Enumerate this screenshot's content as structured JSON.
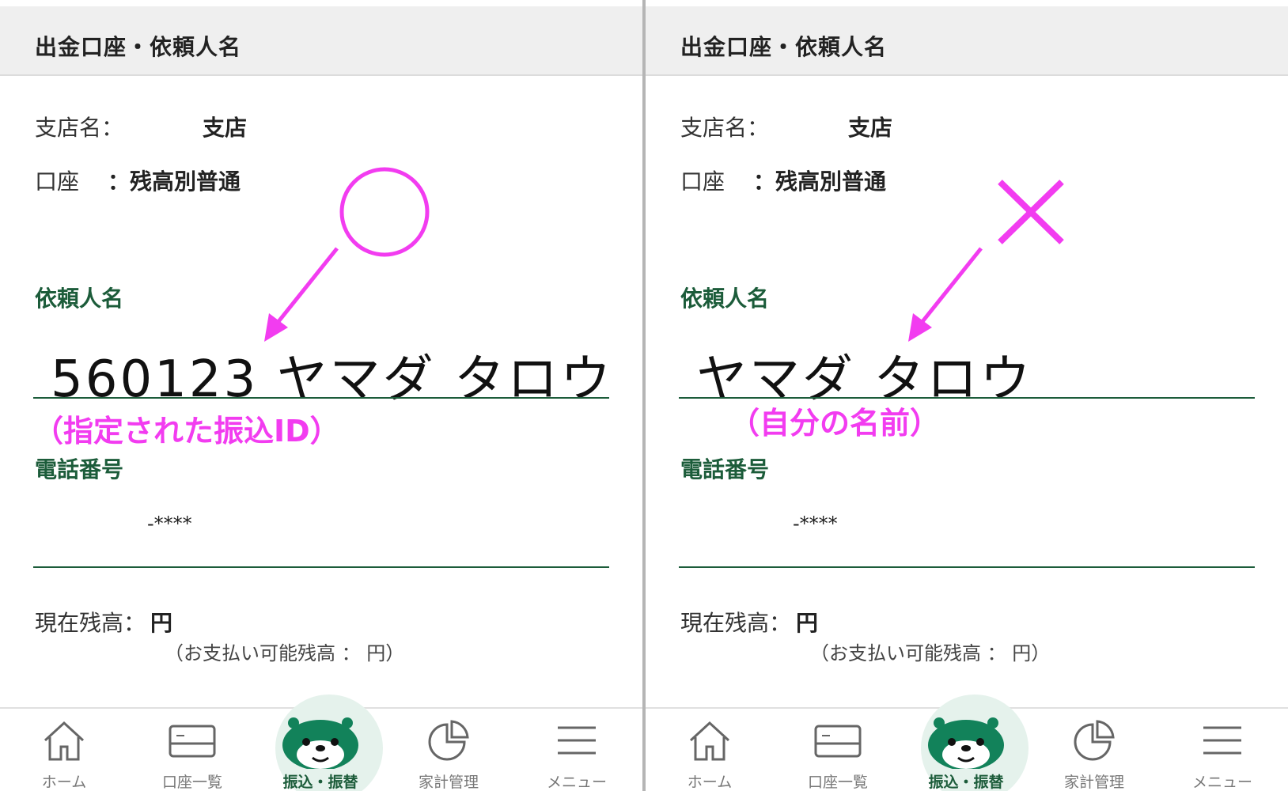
{
  "panels": [
    {
      "header_title": "出金口座・依頼人名",
      "branch_label": "支店名：",
      "branch_value": "支店",
      "account_label": "口座",
      "account_value": "：残高別普通",
      "requester_label": "依頼人名",
      "requester_name": "560123 ヤマダ タロウ",
      "note": "（指定された振込ID）",
      "mark": "○",
      "phone_label": "電話番号",
      "phone_value": "-****",
      "balance_label": "現在残高：",
      "balance_value": "円",
      "available_text": "（お支払い可能残高 ： 円）"
    },
    {
      "header_title": "出金口座・依頼人名",
      "branch_label": "支店名：",
      "branch_value": "支店",
      "account_label": "口座",
      "account_value": "：残高別普通",
      "requester_label": "依頼人名",
      "requester_name": "ヤマダ タロウ",
      "note": "（自分の名前）",
      "mark": "×",
      "phone_label": "電話番号",
      "phone_value": "-****",
      "balance_label": "現在残高：",
      "balance_value": "円",
      "available_text": "（お支払い可能残高 ： 円）"
    }
  ],
  "tabbar": {
    "items": [
      {
        "label": "ホーム",
        "icon": "home-icon"
      },
      {
        "label": "口座一覧",
        "icon": "card-icon"
      },
      {
        "label": "振込・振替",
        "icon": "mascot-icon",
        "active": true
      },
      {
        "label": "家計管理",
        "icon": "pie-chart-icon"
      },
      {
        "label": "メニュー",
        "icon": "menu-icon"
      }
    ]
  },
  "colors": {
    "accent_green": "#1c5c3a",
    "annotation_magenta": "#f23cf0",
    "header_bg": "#efefef"
  }
}
